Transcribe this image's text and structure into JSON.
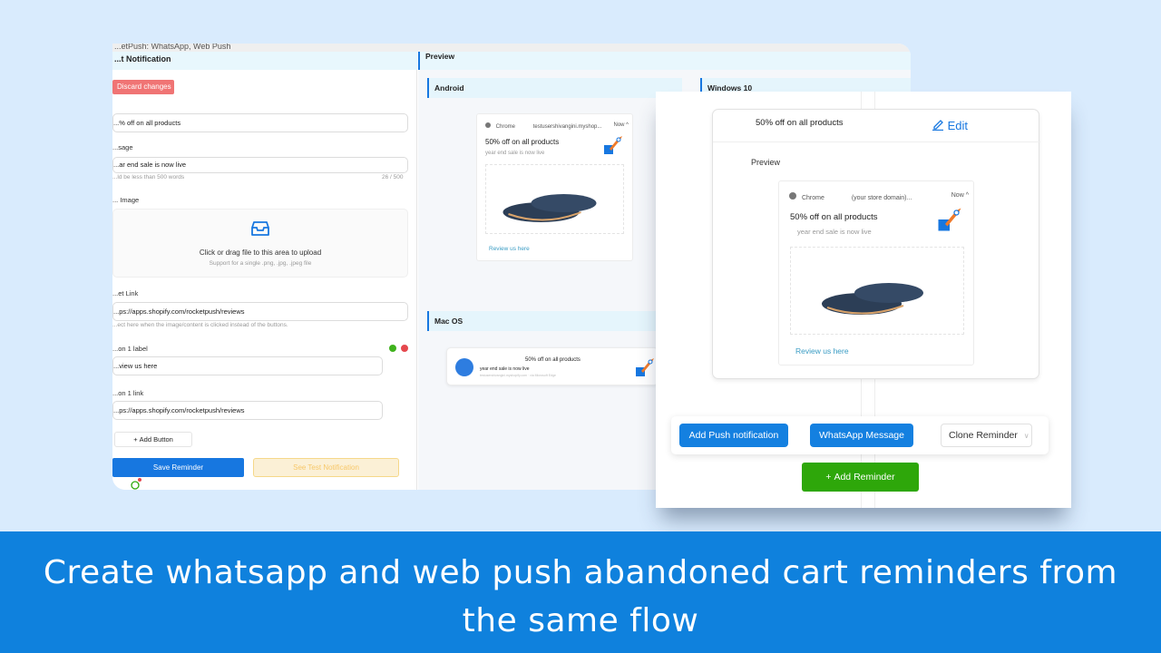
{
  "window": {
    "title": "...etPush: WhatsApp, Web Push",
    "form_header": "...t Notification"
  },
  "form": {
    "discard_label": "Discard changes",
    "title_value": "...% off on all products",
    "message_label": "...sage",
    "message_value": "...ar end sale is now live",
    "message_hint": "...ld be less than 500 words",
    "message_count": "26 / 500",
    "image_label": "... Image",
    "upload_text": "Click or drag file to this area to upload",
    "upload_hint": "Support for a single .png, .jpg, .jpeg file",
    "target_label": "...et Link",
    "target_value": "...ps://apps.shopify.com/rocketpush/reviews",
    "target_hint": "...ect here when the image/content is clicked instead of the buttons.",
    "button1_label_label": "...on 1 label",
    "button1_label_value": "...view us here",
    "button1_link_label": "...on 1 link",
    "button1_link_value": "...ps://apps.shopify.com/rocketpush/reviews",
    "add_button_label": "Add Button",
    "save_label": "Save Reminder",
    "test_label": "See Test Notification"
  },
  "preview": {
    "header": "Preview",
    "android": {
      "section": "Android",
      "browser": "Chrome",
      "domain": "testusershivangini.myshop...",
      "time": "Now",
      "title": "50% off on all products",
      "body": "year end sale is now live",
      "action": "Review us here"
    },
    "macos": {
      "section": "Mac OS",
      "title": "50% off on all products",
      "body": "year end sale is now live",
      "meta": "testusershivangini.myshopify.com · via Microsoft Edge"
    },
    "windows": {
      "section": "Windows 10"
    }
  },
  "overlay": {
    "card_title": "50% off on all products",
    "edit_label": "Edit",
    "preview_label": "Preview",
    "browser": "Chrome",
    "domain": "(your store domain)...",
    "time": "Now",
    "notif_title": "50% off on all products",
    "notif_body": "year end sale is now live",
    "action": "Review us here",
    "add_push_label": "Add Push notification",
    "whatsapp_label": "WhatsApp Message",
    "clone_label": "Clone Reminder",
    "add_reminder_label": "Add Reminder"
  },
  "banner": {
    "line1": "Create whatsapp and web push abandoned cart reminders from",
    "line2": "the same flow"
  },
  "colors": {
    "primary": "#1777e0",
    "danger": "#f07474",
    "success": "#2ea70a",
    "banner": "#0f81dd",
    "background": "#d9ebfd"
  }
}
